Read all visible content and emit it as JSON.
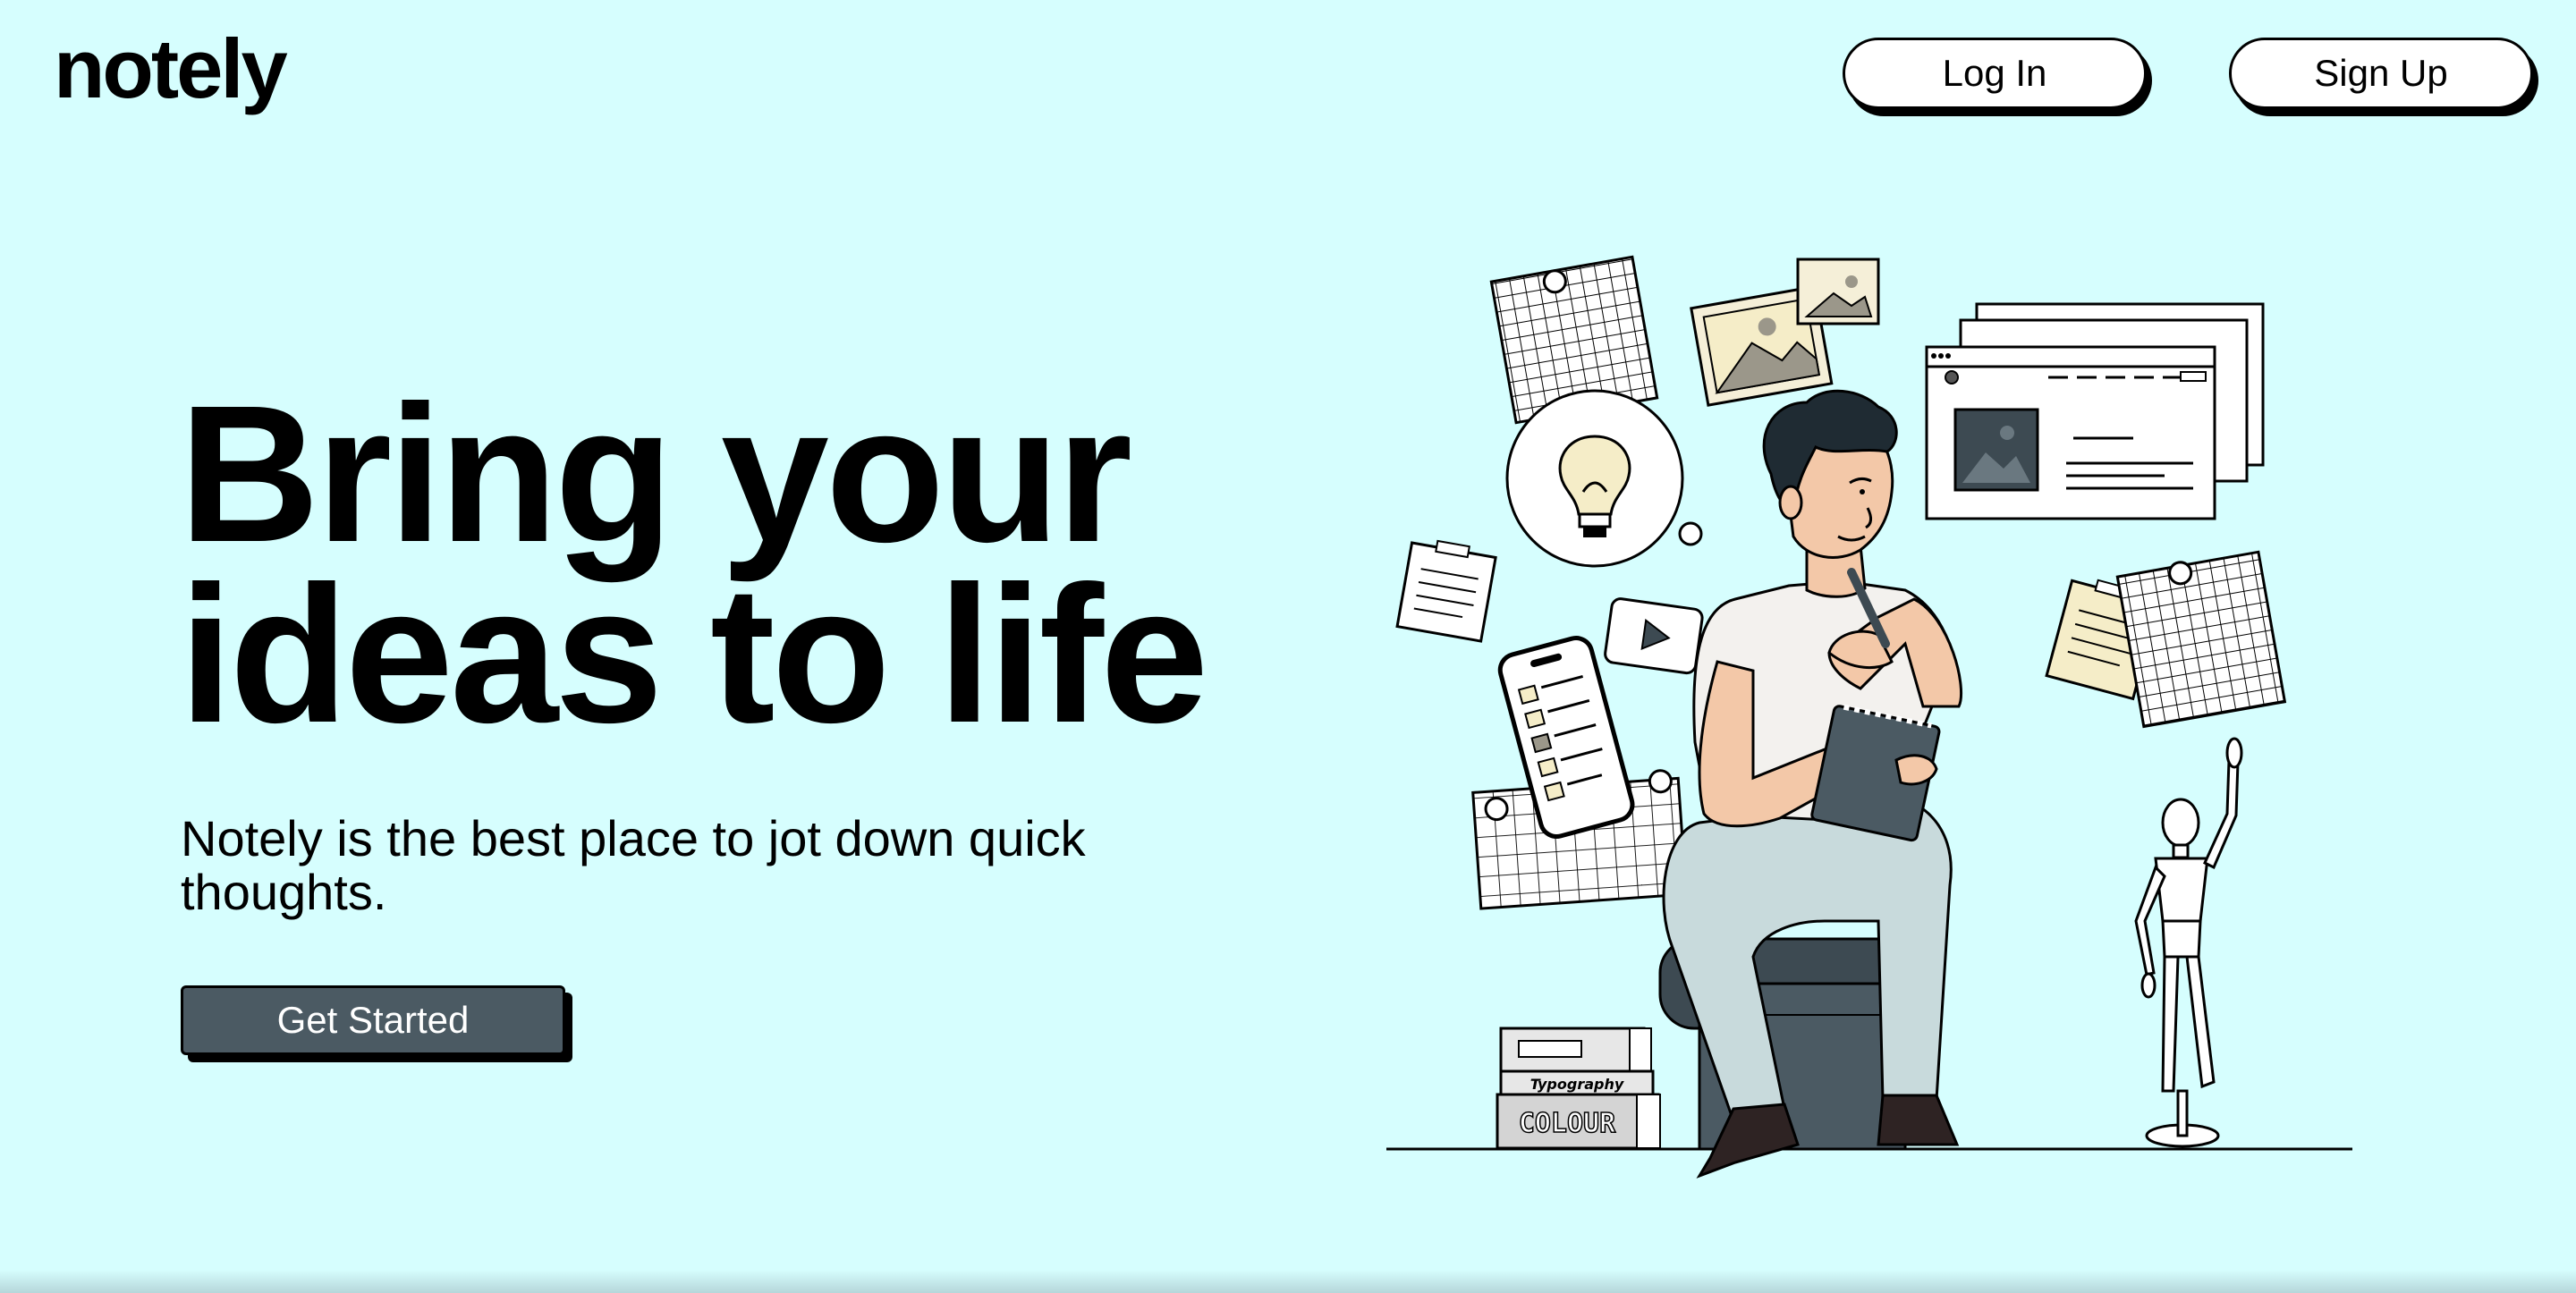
{
  "header": {
    "logo": "notely",
    "login_label": "Log In",
    "signup_label": "Sign Up"
  },
  "hero": {
    "headline_line1": "Bring your",
    "headline_line2": "ideas to life",
    "subtitle": "Notely is the best place to jot down quick thoughts.",
    "cta_label": "Get Started"
  },
  "illustration": {
    "book_top_label": "Typography",
    "book_bottom_label": "COLOUR"
  },
  "colors": {
    "background": "#d6fefe",
    "button_dark": "#4b5a63",
    "outline": "#000000"
  }
}
